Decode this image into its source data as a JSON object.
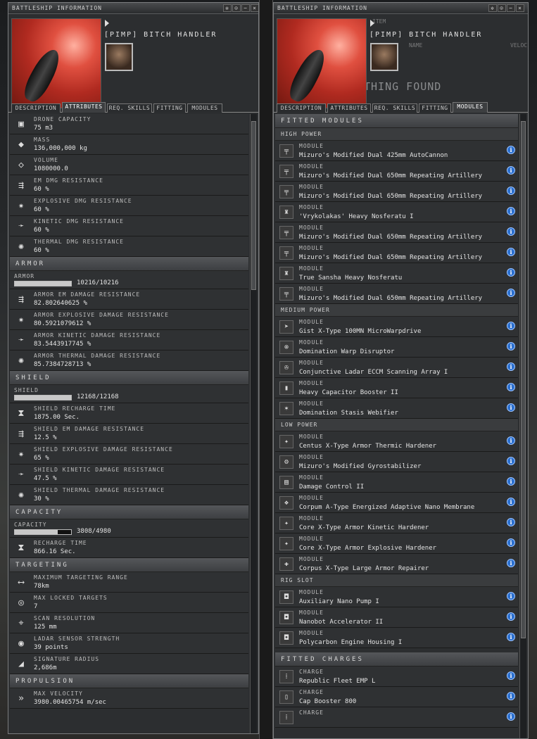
{
  "left": {
    "title": "BATTLESHIP INFORMATION",
    "ship_name": "[PIMP] BITCH HANDLER",
    "tabs": [
      "DESCRIPTION",
      "ATTRIBUTES",
      "REQ. SKILLS",
      "FITTING",
      "MODULES"
    ],
    "active_tab": "ATTRIBUTES",
    "rows_top": [
      {
        "icon": "drone-icon",
        "label": "DRONE CAPACITY",
        "value": "75 m3"
      },
      {
        "icon": "mass-icon",
        "label": "MASS",
        "value": "136,000,000 kg"
      },
      {
        "icon": "volume-icon",
        "label": "VOLUME",
        "value": "1080000.0"
      },
      {
        "icon": "em-resist-icon",
        "label": "EM DMG RESISTANCE",
        "value": "60 %"
      },
      {
        "icon": "explosive-resist-icon",
        "label": "EXPLOSIVE DMG RESISTANCE",
        "value": "60 %"
      },
      {
        "icon": "kinetic-resist-icon",
        "label": "KINETIC DMG RESISTANCE",
        "value": "60 %"
      },
      {
        "icon": "thermal-resist-icon",
        "label": "THERMAL DMG RESISTANCE",
        "value": "60 %"
      }
    ],
    "armor": {
      "section": "ARMOR",
      "bar_label": "ARMOR",
      "bar_value": "10216/10216",
      "bar_fill": 1.0,
      "rows": [
        {
          "icon": "em-resist-icon",
          "label": "ARMOR EM DAMAGE RESISTANCE",
          "value": "82.802640625 %"
        },
        {
          "icon": "explosive-resist-icon",
          "label": "ARMOR EXPLOSIVE DAMAGE RESISTANCE",
          "value": "80.5921079612 %"
        },
        {
          "icon": "kinetic-resist-icon",
          "label": "ARMOR KINETIC DAMAGE RESISTANCE",
          "value": "83.5443917745 %"
        },
        {
          "icon": "thermal-resist-icon",
          "label": "ARMOR THERMAL DAMAGE RESISTANCE",
          "value": "85.7384728713 %"
        }
      ]
    },
    "shield": {
      "section": "SHIELD",
      "bar_label": "SHIELD",
      "bar_value": "12168/12168",
      "bar_fill": 1.0,
      "rows": [
        {
          "icon": "hourglass-icon",
          "label": "SHIELD RECHARGE TIME",
          "value": "1875.00 Sec."
        },
        {
          "icon": "em-resist-icon",
          "label": "SHIELD EM DAMAGE RESISTANCE",
          "value": "12.5 %"
        },
        {
          "icon": "explosive-resist-icon",
          "label": "SHIELD EXPLOSIVE DAMAGE RESISTANCE",
          "value": "65 %"
        },
        {
          "icon": "kinetic-resist-icon",
          "label": "SHIELD KINETIC DAMAGE RESISTANCE",
          "value": "47.5 %"
        },
        {
          "icon": "thermal-resist-icon",
          "label": "SHIELD THERMAL DAMAGE RESISTANCE",
          "value": "30 %"
        }
      ]
    },
    "capacity": {
      "section": "CAPACITY",
      "bar_label": "CAPACITY",
      "bar_value": "3808/4980",
      "bar_fill": 0.765,
      "rows": [
        {
          "icon": "hourglass-icon",
          "label": "RECHARGE TIME",
          "value": "866.16 Sec."
        }
      ]
    },
    "targeting": {
      "section": "TARGETING",
      "rows": [
        {
          "icon": "range-icon",
          "label": "MAXIMUM TARGETING RANGE",
          "value": "78km"
        },
        {
          "icon": "target-icon",
          "label": "MAX LOCKED TARGETS",
          "value": "7"
        },
        {
          "icon": "scan-icon",
          "label": "SCAN RESOLUTION",
          "value": "125 mm"
        },
        {
          "icon": "sensor-icon",
          "label": "LADAR SENSOR STRENGTH",
          "value": "39 points"
        },
        {
          "icon": "signature-icon",
          "label": "SIGNATURE RADIUS",
          "value": "2,686m"
        }
      ]
    },
    "propulsion": {
      "section": "PROPULSION",
      "rows": [
        {
          "icon": "velocity-icon",
          "label": "MAX VELOCITY",
          "value": "3980.00465754 m/sec"
        }
      ]
    }
  },
  "right": {
    "title": "BATTLESHIP INFORMATION",
    "ship_name": "[PIMP] BITCH HANDLER",
    "ghost_item": "ITEM",
    "ghost_name": "NAME",
    "ghost_veloc": "VELOCI",
    "ghost_found": "THING FOUND",
    "tabs": [
      "DESCRIPTION",
      "ATTRIBUTES",
      "REQ. SKILLS",
      "FITTING",
      "MODULES"
    ],
    "active_tab": "MODULES",
    "fitted_modules": "FITTED MODULES",
    "high_power": {
      "label": "HIGH POWER",
      "items": [
        {
          "icon": "autocannon-icon",
          "type": "MODULE",
          "name": "Mizuro's Modified Dual 425mm AutoCannon"
        },
        {
          "icon": "artillery-icon",
          "type": "MODULE",
          "name": "Mizuro's Modified Dual 650mm Repeating Artillery"
        },
        {
          "icon": "artillery-icon",
          "type": "MODULE",
          "name": "Mizuro's Modified Dual 650mm Repeating Artillery"
        },
        {
          "icon": "nosferatu-icon",
          "type": "MODULE",
          "name": "'Vrykolakas' Heavy Nosferatu I"
        },
        {
          "icon": "artillery-icon",
          "type": "MODULE",
          "name": "Mizuro's Modified Dual 650mm Repeating Artillery"
        },
        {
          "icon": "artillery-icon",
          "type": "MODULE",
          "name": "Mizuro's Modified Dual 650mm Repeating Artillery"
        },
        {
          "icon": "nosferatu-icon",
          "type": "MODULE",
          "name": "True Sansha Heavy Nosferatu"
        },
        {
          "icon": "artillery-icon",
          "type": "MODULE",
          "name": "Mizuro's Modified Dual 650mm Repeating Artillery"
        }
      ]
    },
    "medium_power": {
      "label": "MEDIUM POWER",
      "items": [
        {
          "icon": "microwarpdrive-icon",
          "type": "MODULE",
          "name": "Gist X-Type 100MN MicroWarpdrive"
        },
        {
          "icon": "warp-disruptor-icon",
          "type": "MODULE",
          "name": "Domination Warp Disruptor"
        },
        {
          "icon": "eccm-icon",
          "type": "MODULE",
          "name": "Conjunctive Ladar ECCM Scanning Array I"
        },
        {
          "icon": "cap-booster-icon",
          "type": "MODULE",
          "name": "Heavy Capacitor Booster II"
        },
        {
          "icon": "webifier-icon",
          "type": "MODULE",
          "name": "Domination Stasis Webifier"
        }
      ]
    },
    "low_power": {
      "label": "LOW POWER",
      "items": [
        {
          "icon": "hardener-icon",
          "type": "MODULE",
          "name": "Centus X-Type Armor Thermic Hardener"
        },
        {
          "icon": "gyrostabilizer-icon",
          "type": "MODULE",
          "name": "Mizuro's Modified Gyrostabilizer"
        },
        {
          "icon": "damage-control-icon",
          "type": "MODULE",
          "name": "Damage Control II"
        },
        {
          "icon": "membrane-icon",
          "type": "MODULE",
          "name": "Corpum A-Type Energized Adaptive Nano Membrane"
        },
        {
          "icon": "hardener-icon",
          "type": "MODULE",
          "name": "Core X-Type Armor Kinetic Hardener"
        },
        {
          "icon": "hardener-icon",
          "type": "MODULE",
          "name": "Core X-Type Armor Explosive Hardener"
        },
        {
          "icon": "armor-repairer-icon",
          "type": "MODULE",
          "name": "Corpus X-Type Large Armor Repairer"
        }
      ]
    },
    "rig_slot": {
      "label": "RIG SLOT",
      "items": [
        {
          "icon": "rig-icon",
          "type": "MODULE",
          "name": "Auxiliary Nano Pump I"
        },
        {
          "icon": "rig-icon",
          "type": "MODULE",
          "name": "Nanobot Accelerator II"
        },
        {
          "icon": "rig-icon",
          "type": "MODULE",
          "name": "Polycarbon Engine Housing I"
        }
      ]
    },
    "fitted_charges": "FITTED CHARGES",
    "charges": [
      {
        "icon": "ammo-icon",
        "type": "CHARGE",
        "name": "Republic Fleet EMP L"
      },
      {
        "icon": "cap-charge-icon",
        "type": "CHARGE",
        "name": "Cap Booster 800"
      },
      {
        "icon": "ammo-icon",
        "type": "CHARGE",
        "name": ""
      }
    ]
  },
  "titlebar_buttons": [
    "✲",
    "⊙",
    "−",
    "×"
  ]
}
